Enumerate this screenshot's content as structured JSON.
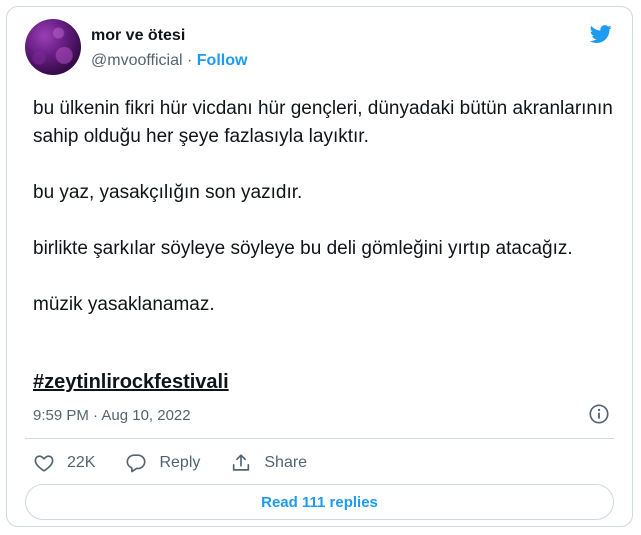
{
  "account": {
    "name": "mor ve ötesi",
    "handle": "@mvoofficial",
    "separator": "·",
    "follow_label": "Follow"
  },
  "tweet": {
    "paragraphs": [
      "bu ülkenin fikri hür vicdanı hür gençleri, dünyadaki bütün akranlarının sahip olduğu her şeye fazlasıyla layıktır.",
      "bu yaz, yasakçılığın son yazıdır.",
      "birlikte şarkılar söyleye söyleye bu deli gömleğini yırtıp atacağız.",
      "müzik yasaklanamaz."
    ],
    "hashtag": "#zeytinlirockfestivali",
    "timestamp": "9:59 PM · Aug 10, 2022"
  },
  "actions": {
    "like_count": "22K",
    "reply_label": "Reply",
    "share_label": "Share"
  },
  "replies_button": "Read 111 replies",
  "icons": {
    "brand": "twitter-bird-icon",
    "info": "info-icon",
    "like": "heart-icon",
    "reply": "reply-bubble-icon",
    "share": "share-icon"
  },
  "colors": {
    "accent": "#1d9bf0",
    "text": "#0f1419",
    "muted": "#536471",
    "border": "#cfd9de"
  }
}
